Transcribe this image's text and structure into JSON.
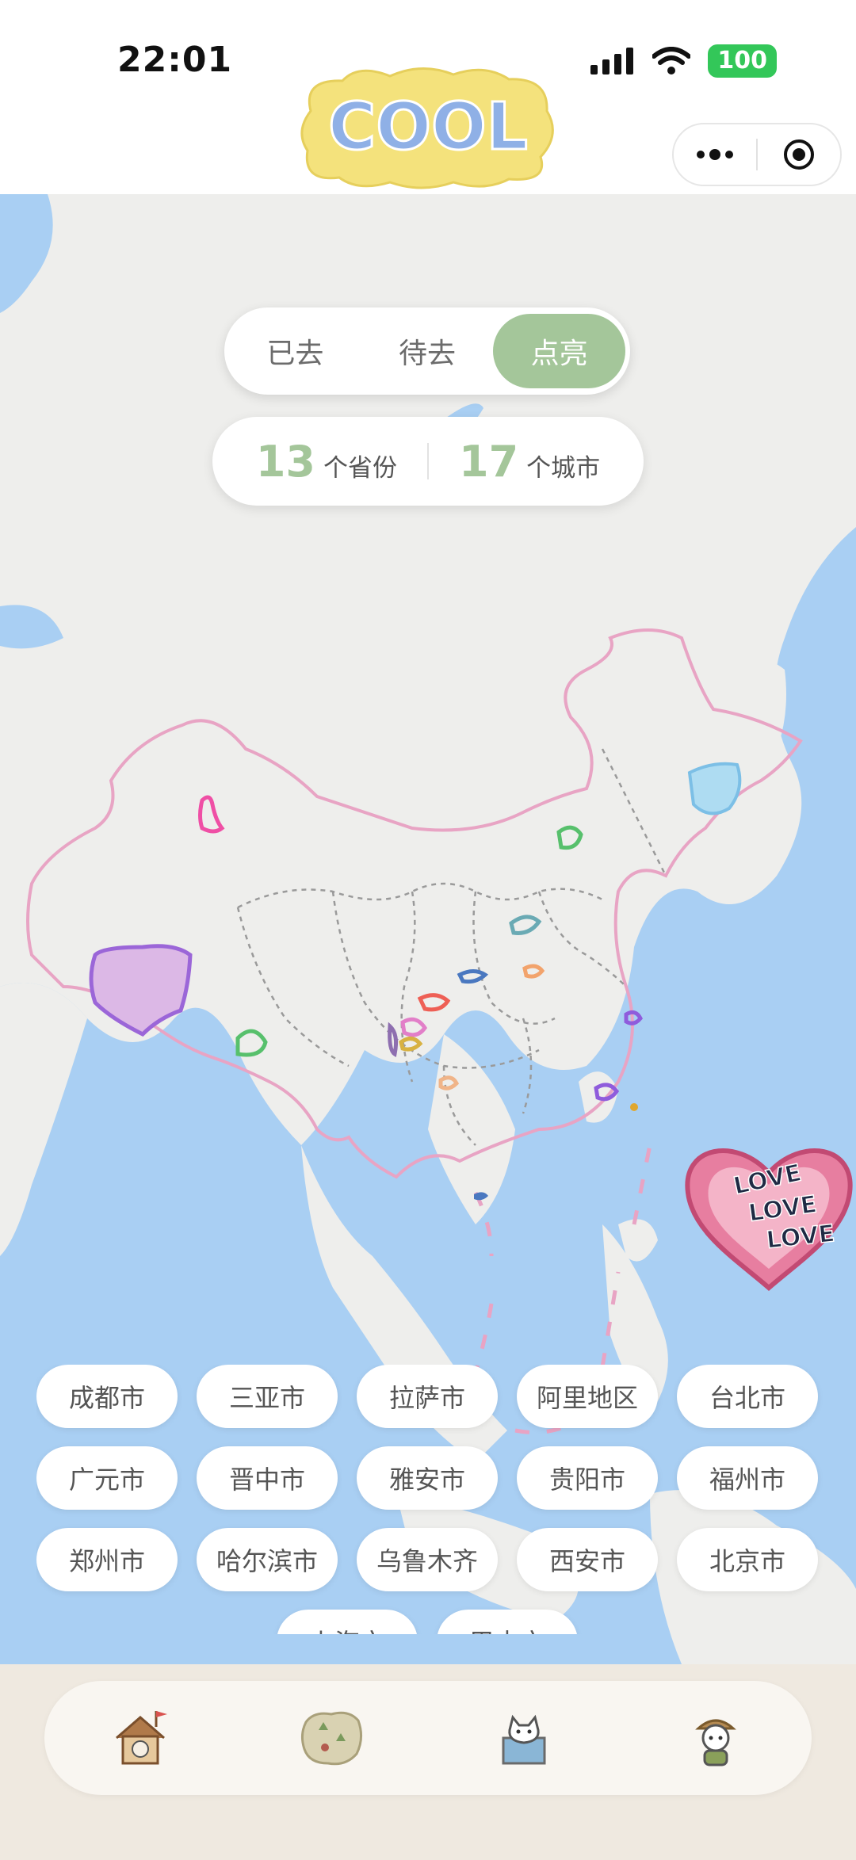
{
  "status_bar": {
    "time": "22:01",
    "battery": "100"
  },
  "app": {
    "logo_text": "COOL"
  },
  "segment": {
    "tabs": [
      "已去",
      "待去",
      "点亮"
    ],
    "active_index": 2
  },
  "stats": {
    "provinces_count": "13",
    "provinces_unit": "个省份",
    "cities_count": "17",
    "cities_unit": "个城市"
  },
  "sticker": {
    "line1": "LOVE",
    "line2": "LOVE",
    "line3": "LOVE"
  },
  "cities": [
    "成都市",
    "三亚市",
    "拉萨市",
    "阿里地区",
    "台北市",
    "广元市",
    "晋中市",
    "雅安市",
    "贵阳市",
    "福州市",
    "郑州市",
    "哈尔滨市",
    "乌鲁木齐",
    "西安市",
    "北京市",
    "上海市",
    "巴中市"
  ],
  "tabbar": {
    "icons": [
      "home-house-icon",
      "map-icon",
      "photo-cat-icon",
      "explorer-avatar-icon"
    ]
  },
  "colors": {
    "accent": "#a4c69a",
    "ocean": "#a9cff3",
    "land": "#eeeeec",
    "border": "#e8a4c4"
  }
}
